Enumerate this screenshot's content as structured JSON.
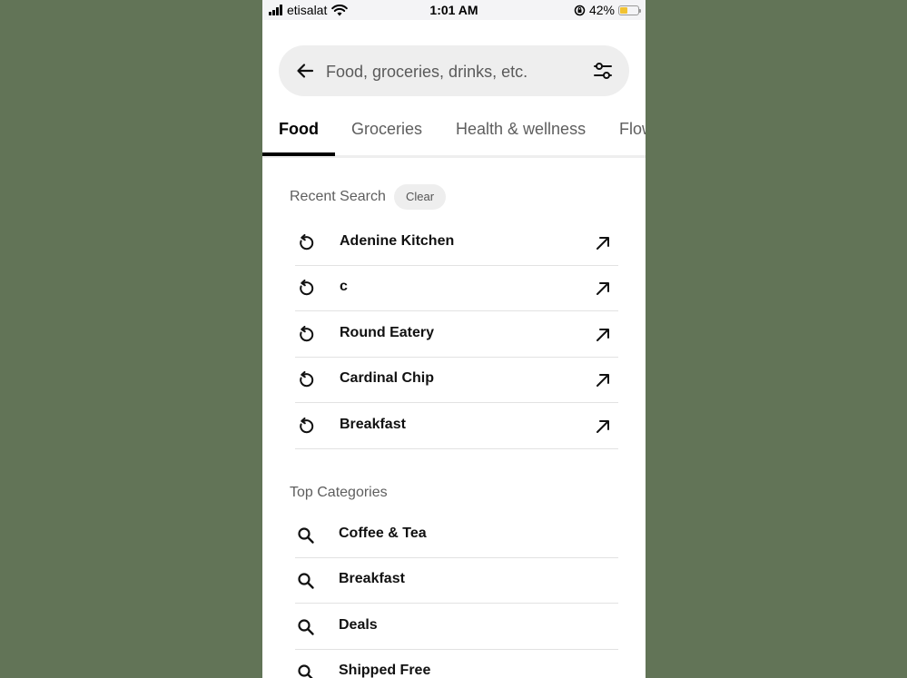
{
  "status_bar": {
    "carrier": "etisalat",
    "time": "1:01 AM",
    "battery_percent": "42%",
    "battery_level": 0.42,
    "battery_color": "#f1c232"
  },
  "search": {
    "placeholder": "Food, groceries, drinks, etc.",
    "back_icon": "arrow-left-icon",
    "filter_icon": "sliders-icon"
  },
  "tabs": [
    {
      "label": "Food",
      "active": true
    },
    {
      "label": "Groceries",
      "active": false
    },
    {
      "label": "Health & wellness",
      "active": false
    },
    {
      "label": "Flowers",
      "active": false
    }
  ],
  "recent": {
    "title": "Recent Search",
    "clear_label": "Clear",
    "items": [
      {
        "label": "Adenine Kitchen"
      },
      {
        "label": "c"
      },
      {
        "label": "Round Eatery"
      },
      {
        "label": "Cardinal Chip"
      },
      {
        "label": "Breakfast"
      }
    ]
  },
  "top_categories": {
    "title": "Top Categories",
    "items": [
      {
        "label": "Coffee & Tea"
      },
      {
        "label": "Breakfast"
      },
      {
        "label": "Deals"
      },
      {
        "label": "Shipped Free"
      }
    ]
  },
  "colors": {
    "backdrop": "#627457",
    "pill_bg": "#eeeeee",
    "active_tab": "#000000"
  }
}
